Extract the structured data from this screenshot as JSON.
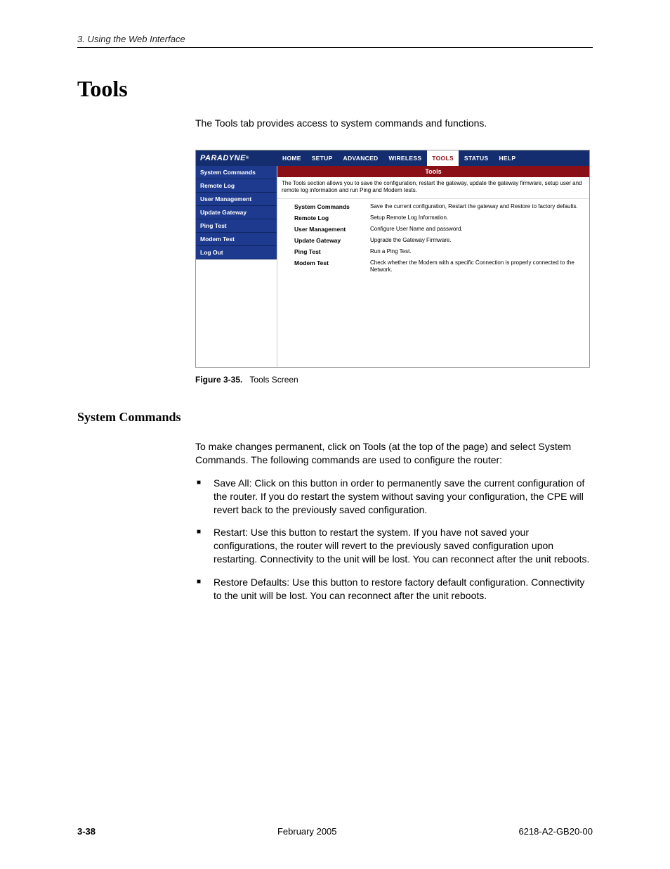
{
  "header": {
    "running_head": "3. Using the Web Interface"
  },
  "section": {
    "title": "Tools",
    "intro": "The Tools tab provides access to system commands and functions."
  },
  "screenshot": {
    "brand": "PARADYNE",
    "tabs": [
      "HOME",
      "SETUP",
      "ADVANCED",
      "WIRELESS",
      "TOOLS",
      "STATUS",
      "HELP"
    ],
    "active_tab_index": 4,
    "sidebar": [
      "System Commands",
      "Remote Log",
      "User Management",
      "Update Gateway",
      "Ping Test",
      "Modem Test",
      "Log Out"
    ],
    "panel_title": "Tools",
    "panel_intro": "The Tools section allows you to save the configuration, restart the gateway, update the gateway firmware, setup user and remote log information and run Ping and Modem tests.",
    "rows": [
      {
        "label": "System Commands",
        "desc": "Save the current configuration, Restart the gateway and Restore to factory defaults."
      },
      {
        "label": "Remote Log",
        "desc": "Setup Remote Log Information."
      },
      {
        "label": "User Management",
        "desc": "Configure User Name and password."
      },
      {
        "label": "Update Gateway",
        "desc": "Upgrade the Gateway Firmware."
      },
      {
        "label": "Ping Test",
        "desc": "Run a Ping Test."
      },
      {
        "label": "Modem Test",
        "desc": "Check whether the Modem with a specific Connection is properly connected to the Network."
      }
    ]
  },
  "figure": {
    "number": "Figure 3-35.",
    "title": "Tools Screen"
  },
  "subsection": {
    "title": "System Commands",
    "para": "To make changes permanent, click on Tools (at the top of the page) and select System Commands. The following commands are used to configure the router:",
    "bullets": [
      "Save All: Click on this button in order to permanently save the current configuration of the router. If you do restart the system without saving your configuration, the CPE will revert back to the previously saved configuration.",
      "Restart: Use this button to restart the system. If you have not saved your configurations, the router will revert to the previously saved configuration upon restarting. Connectivity to the unit will be lost. You can reconnect after the unit reboots.",
      "Restore Defaults: Use this button to restore factory default configuration. Connectivity to the unit will be lost. You can reconnect after the unit reboots."
    ]
  },
  "footer": {
    "page": "3-38",
    "date": "February 2005",
    "doc": "6218-A2-GB20-00"
  }
}
